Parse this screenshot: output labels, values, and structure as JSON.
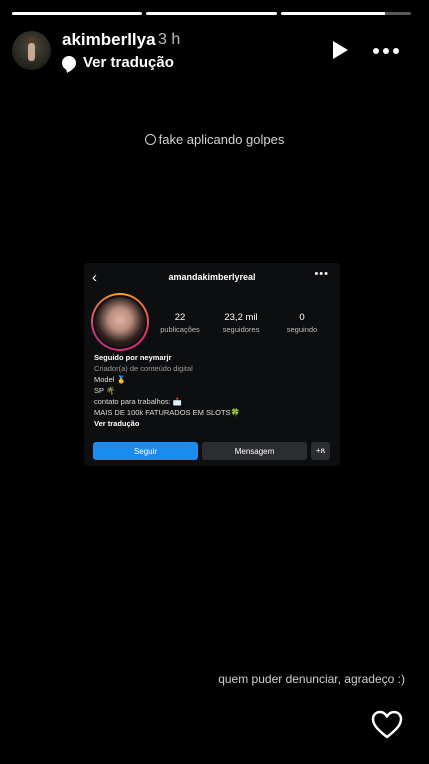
{
  "progress": [
    1,
    1,
    0.8
  ],
  "header": {
    "username": "akimberllya",
    "time": "3 h",
    "translate_label": "Ver tradução"
  },
  "overlay": {
    "top_text": "fake aplicando golpes",
    "bottom_text": "quem puder denunciar, agradeço :)"
  },
  "profile_card": {
    "username": "amandakimberlyreal",
    "stats": [
      {
        "value": "22",
        "label": "publicações"
      },
      {
        "value": "23,2 mil",
        "label": "seguidores"
      },
      {
        "value": "0",
        "label": "seguindo"
      }
    ],
    "followed_by": "Seguido por neymarjr",
    "category": "Criador(a) de conteúdo digital",
    "bio_lines": [
      "Model 🥇",
      "SP 🌴",
      "contato para trabalhos: 📩",
      "MAIS DE 100k FATURADOS EM SLOTS🍀"
    ],
    "translate_label": "Ver tradução",
    "follow_label": "Seguir",
    "message_label": "Mensagem",
    "add_label": "+ጸ"
  }
}
